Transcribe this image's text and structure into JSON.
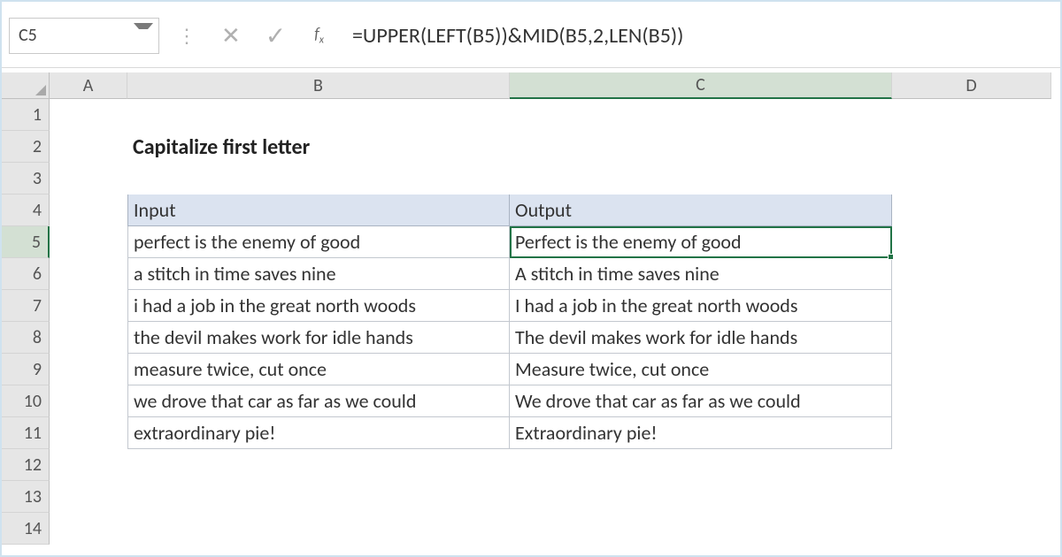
{
  "name_box": "C5",
  "formula": "=UPPER(LEFT(B5))&MID(B5,2,LEN(B5))",
  "fx_label": "fx",
  "columns": [
    "A",
    "B",
    "C",
    "D"
  ],
  "selected_column": "C",
  "rows": [
    "1",
    "2",
    "3",
    "4",
    "5",
    "6",
    "7",
    "8",
    "9",
    "10",
    "11",
    "12",
    "13",
    "14"
  ],
  "selected_row": "5",
  "title": "Capitalize first letter",
  "table": {
    "headers": {
      "input": "Input",
      "output": "Output"
    },
    "rows": [
      {
        "input": "perfect is the enemy of good",
        "output": "Perfect is the enemy of good"
      },
      {
        "input": "a stitch in time saves nine",
        "output": "A stitch in time saves nine"
      },
      {
        "input": "i had a job in the great north woods",
        "output": "I had a job in the great north woods"
      },
      {
        "input": "the devil makes work for idle hands",
        "output": "The devil makes work for idle hands"
      },
      {
        "input": "measure twice, cut once",
        "output": "Measure twice, cut once"
      },
      {
        "input": "we drove that car as far as we could",
        "output": "We drove that car as far as we could"
      },
      {
        "input": "extraordinary pie!",
        "output": "Extraordinary pie!"
      }
    ]
  }
}
